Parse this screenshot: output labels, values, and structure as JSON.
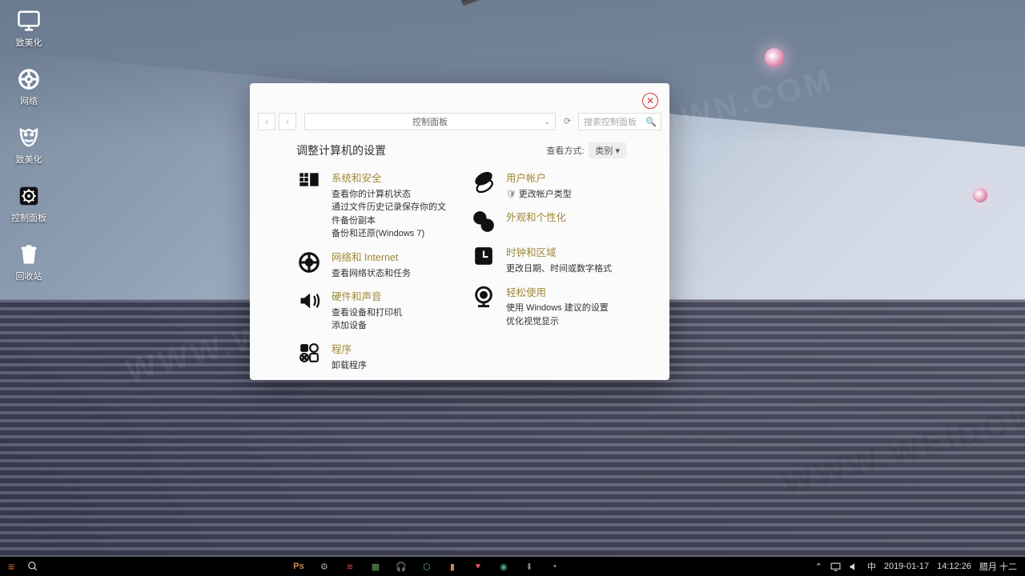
{
  "desktop_icons": [
    {
      "name": "beautify",
      "label": "致美化"
    },
    {
      "name": "network",
      "label": "网络"
    },
    {
      "name": "beautify2",
      "label": "致美化"
    },
    {
      "name": "control-panel",
      "label": "控制面板"
    },
    {
      "name": "recycle-bin",
      "label": "回收站"
    }
  ],
  "watermark": "WWW.WEIDOWN.COM",
  "window": {
    "breadcrumb": "控制面板",
    "search_placeholder": "搜索控制面板",
    "heading": "调整计算机的设置",
    "view_label": "查看方式:",
    "view_value": "类别",
    "categories_left": [
      {
        "title": "系统和安全",
        "links": [
          "查看你的计算机状态",
          "通过文件历史记录保存你的文件备份副本",
          "备份和还原(Windows 7)"
        ]
      },
      {
        "title": "网络和 Internet",
        "links": [
          "查看网络状态和任务"
        ]
      },
      {
        "title": "硬件和声音",
        "links": [
          "查看设备和打印机",
          "添加设备"
        ]
      },
      {
        "title": "程序",
        "links": [
          "卸载程序"
        ]
      }
    ],
    "categories_right": [
      {
        "title": "用户帐户",
        "links": [
          "更改帐户类型"
        ],
        "shield": true
      },
      {
        "title": "外观和个性化",
        "links": []
      },
      {
        "title": "时钟和区域",
        "links": [
          "更改日期、时间或数字格式"
        ]
      },
      {
        "title": "轻松使用",
        "links": [
          "使用 Windows 建议的设置",
          "优化视觉显示"
        ]
      }
    ]
  },
  "taskbar": {
    "apps": [
      "Ps",
      "gear",
      "net",
      "files",
      "audio",
      "shield",
      "note",
      "heart",
      "camera",
      "download",
      "term"
    ],
    "ps_label": "Ps",
    "ime": "中",
    "date": "2019-01-17",
    "time": "14:12:26",
    "lunar": "腊月 十二"
  }
}
